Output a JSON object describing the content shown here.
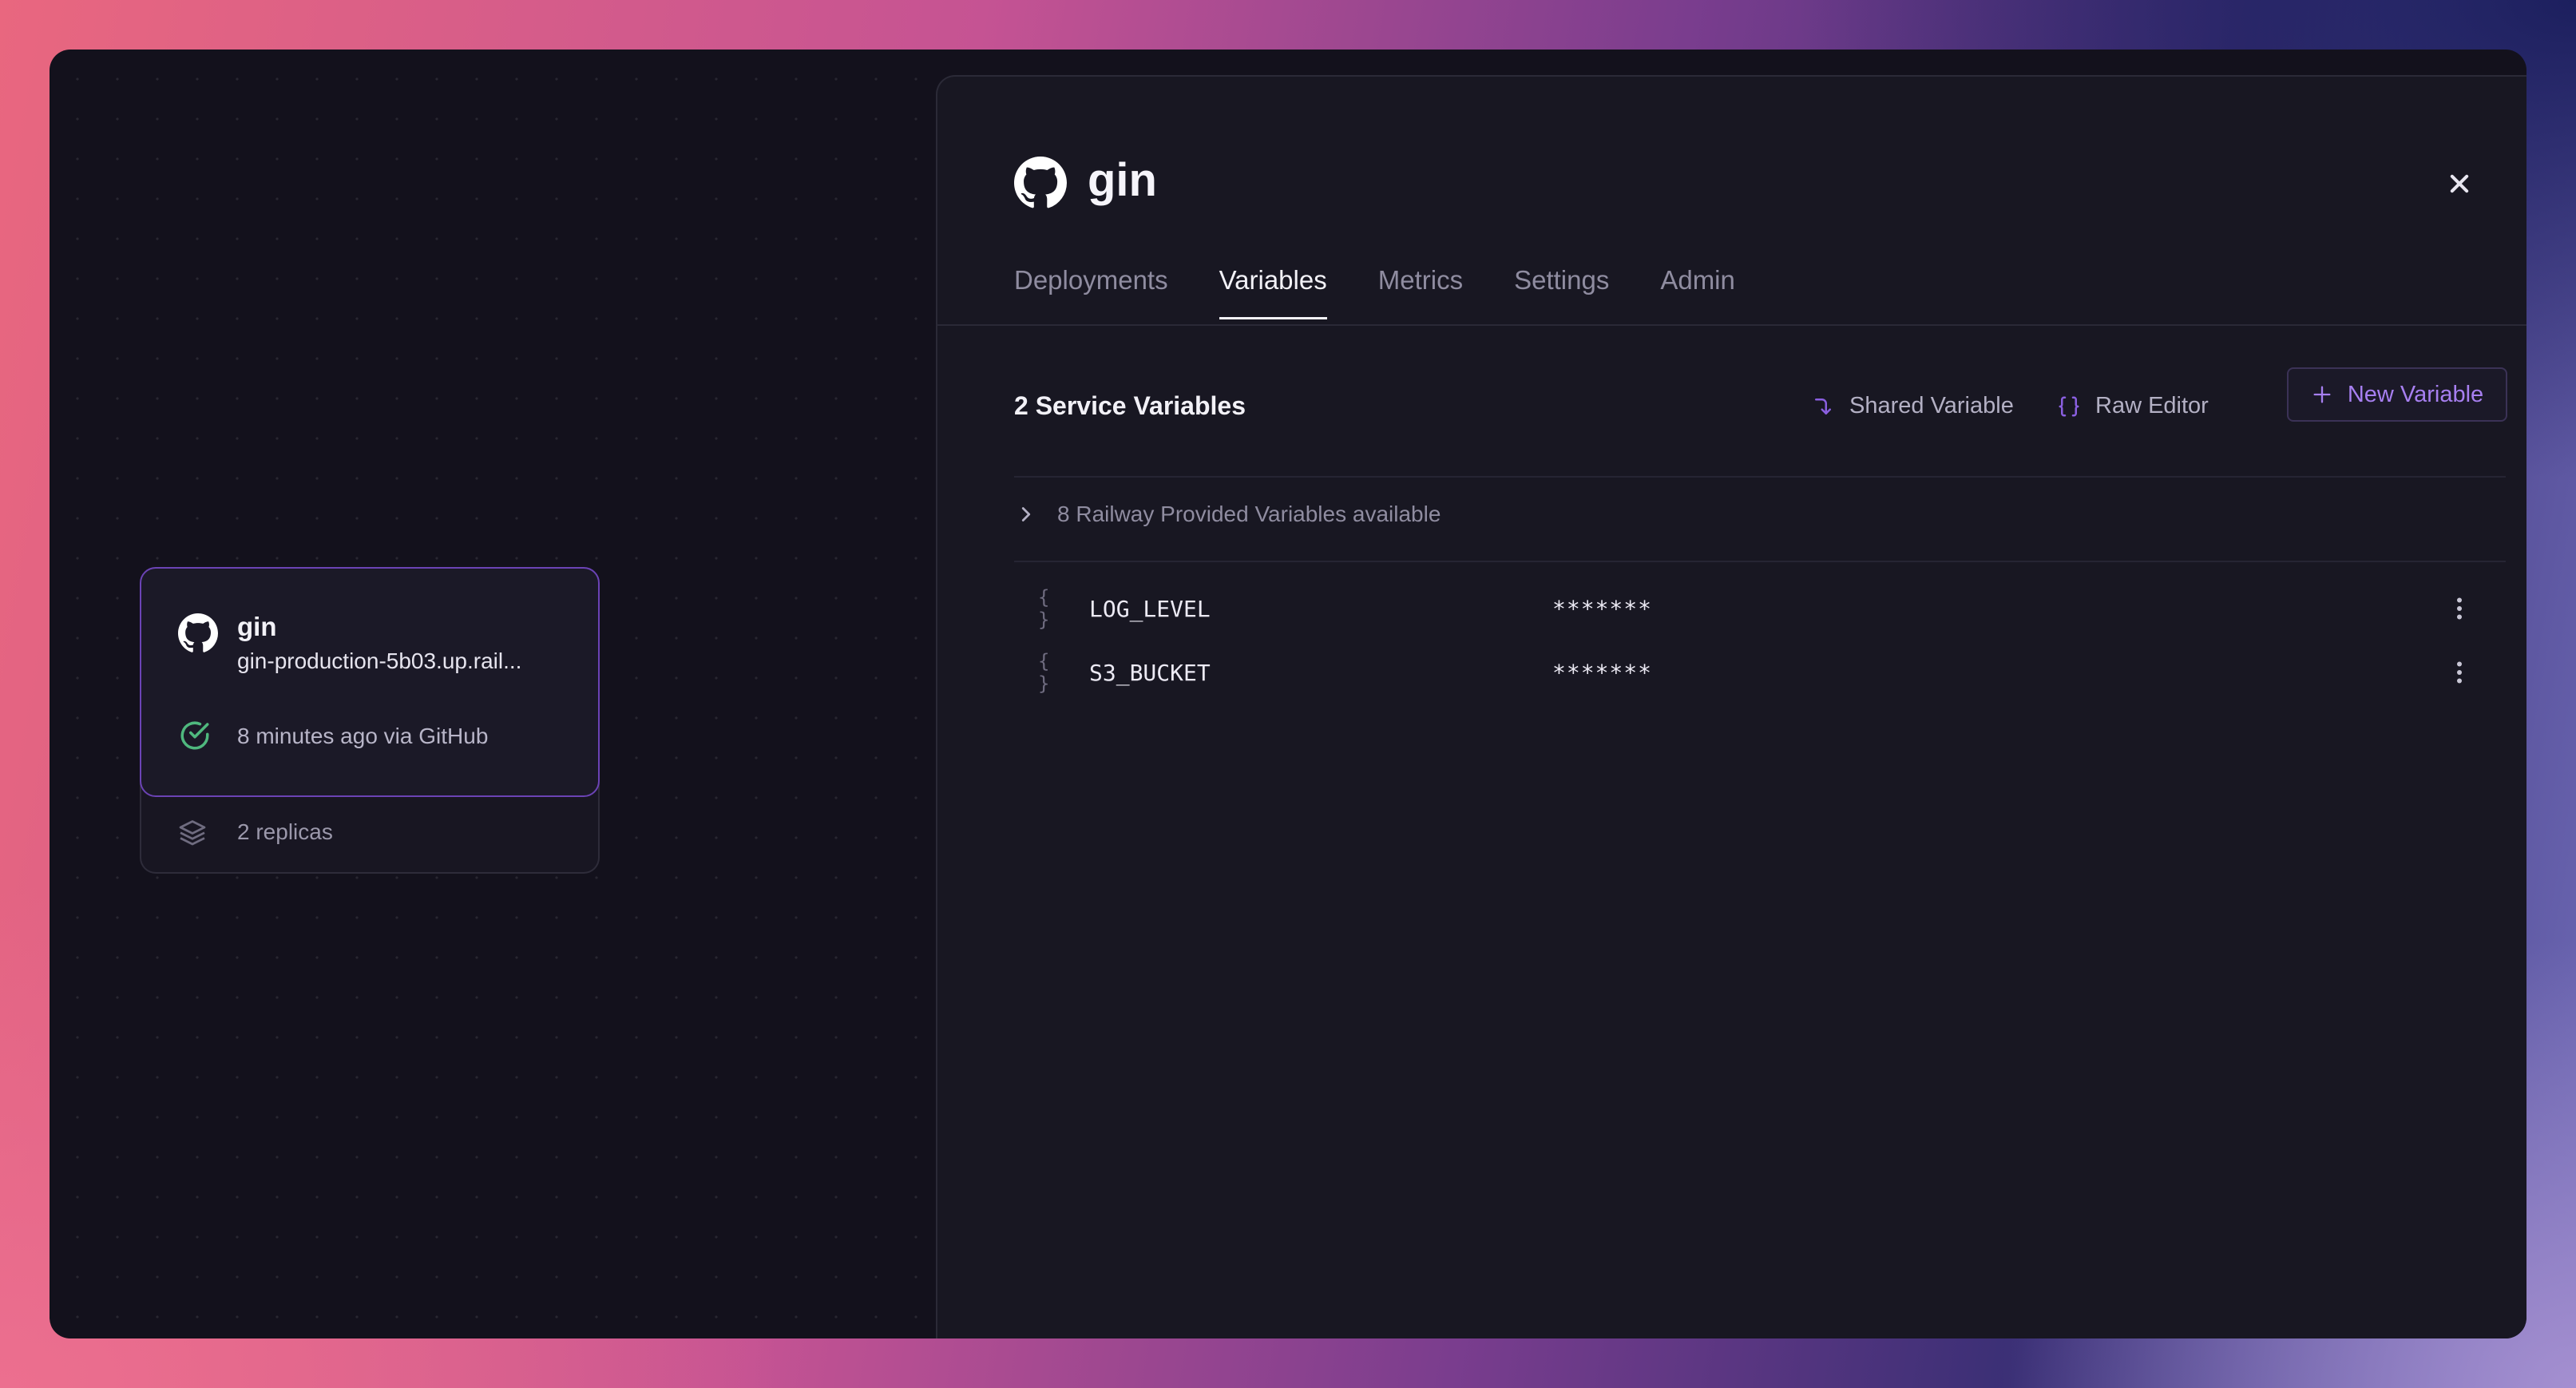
{
  "service_card": {
    "name": "gin",
    "url": "gin-production-5b03.up.rail...",
    "status": "8 minutes ago via GitHub",
    "replicas": "2 replicas",
    "icons": {
      "repo": "github-icon",
      "status": "check-circle-icon",
      "replicas": "layers-icon"
    },
    "colors": {
      "border": "#6b43b5",
      "status": "#4fb87e"
    }
  },
  "panel": {
    "title": "gin",
    "tabs": [
      {
        "label": "Deployments",
        "active": false
      },
      {
        "label": "Variables",
        "active": true
      },
      {
        "label": "Metrics",
        "active": false
      },
      {
        "label": "Settings",
        "active": false
      },
      {
        "label": "Admin",
        "active": false
      }
    ],
    "variables": {
      "heading": "2 Service Variables",
      "shared_label": "Shared Variable",
      "raw_label": "Raw Editor",
      "new_label": "New Variable",
      "provided_label": "8 Railway Provided Variables available",
      "items": [
        {
          "name": "LOG_LEVEL",
          "value": "*******"
        },
        {
          "name": "S3_BUCKET",
          "value": "*******"
        }
      ]
    }
  },
  "colors": {
    "accent": "#8a5fe0",
    "panel_bg": "#181722",
    "canvas_bg": "#13111c"
  }
}
